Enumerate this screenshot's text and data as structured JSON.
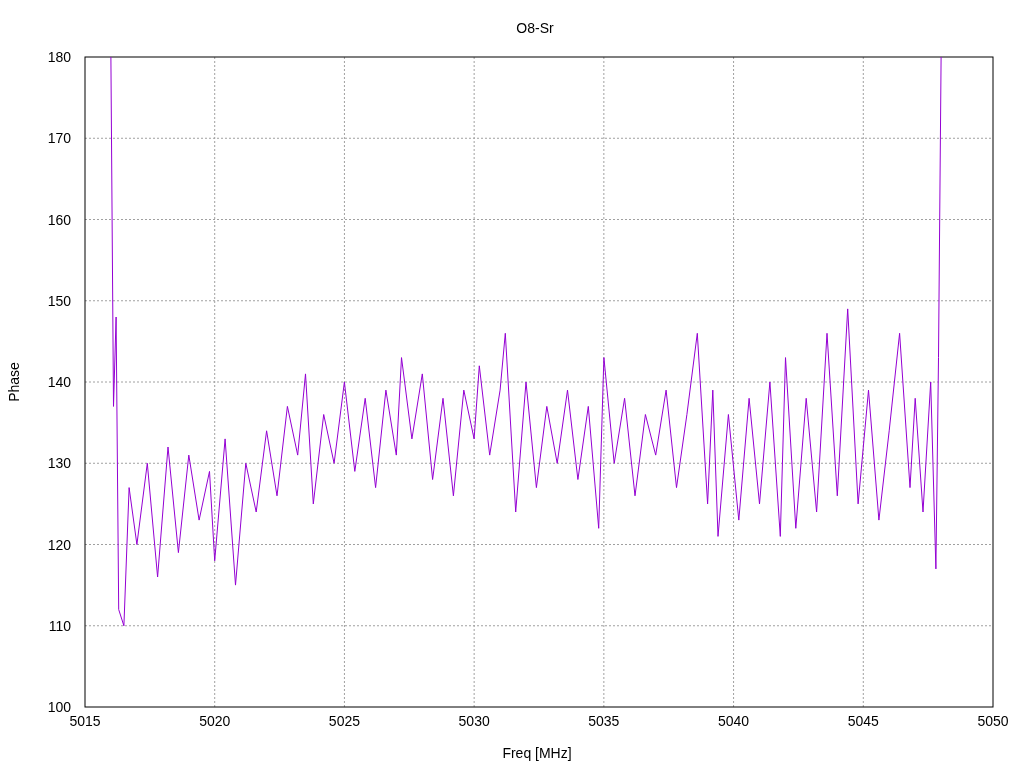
{
  "chart_data": {
    "type": "line",
    "grid": true,
    "title": "O8-Sr",
    "xlabel": "Freq [MHz]",
    "ylabel": "Phase",
    "xlim": [
      5015,
      5050
    ],
    "ylim": [
      100,
      180
    ],
    "xticks": [
      5015,
      5020,
      5025,
      5030,
      5035,
      5040,
      5045,
      5050
    ],
    "yticks": [
      100,
      110,
      120,
      130,
      140,
      150,
      160,
      170,
      180
    ],
    "x": [
      5016.0,
      5016.1,
      5016.2,
      5016.3,
      5016.5,
      5016.7,
      5017.0,
      5017.4,
      5017.8,
      5018.2,
      5018.6,
      5019.0,
      5019.4,
      5019.8,
      5020.0,
      5020.4,
      5020.8,
      5021.2,
      5021.6,
      5022.0,
      5022.4,
      5022.8,
      5023.2,
      5023.5,
      5023.8,
      5024.2,
      5024.6,
      5025.0,
      5025.4,
      5025.8,
      5026.2,
      5026.6,
      5027.0,
      5027.2,
      5027.6,
      5028.0,
      5028.4,
      5028.8,
      5029.2,
      5029.6,
      5030.0,
      5030.2,
      5030.6,
      5031.0,
      5031.2,
      5031.6,
      5032.0,
      5032.4,
      5032.8,
      5033.2,
      5033.6,
      5034.0,
      5034.4,
      5034.8,
      5035.0,
      5035.4,
      5035.8,
      5036.2,
      5036.6,
      5037.0,
      5037.4,
      5037.8,
      5038.2,
      5038.6,
      5039.0,
      5039.2,
      5039.4,
      5039.8,
      5040.2,
      5040.6,
      5041.0,
      5041.4,
      5041.8,
      5042.0,
      5042.4,
      5042.8,
      5043.2,
      5043.6,
      5044.0,
      5044.4,
      5044.8,
      5045.2,
      5045.6,
      5046.0,
      5046.4,
      5046.8,
      5047.0,
      5047.3,
      5047.6,
      5047.8,
      5047.9,
      5048.0
    ],
    "series": [
      {
        "color": "#9400d3",
        "values": [
          180,
          137,
          148,
          112,
          110,
          127,
          120,
          130,
          116,
          132,
          119,
          131,
          123,
          129,
          118,
          133,
          115,
          130,
          124,
          134,
          126,
          137,
          131,
          141,
          125,
          136,
          130,
          140,
          129,
          138,
          127,
          139,
          131,
          143,
          133,
          141,
          128,
          138,
          126,
          139,
          133,
          142,
          131,
          139,
          146,
          124,
          140,
          127,
          137,
          130,
          139,
          128,
          137,
          122,
          143,
          130,
          138,
          126,
          136,
          131,
          139,
          127,
          136,
          146,
          125,
          139,
          121,
          136,
          123,
          138,
          125,
          140,
          121,
          143,
          122,
          138,
          124,
          146,
          126,
          149,
          125,
          139,
          123,
          134,
          146,
          127,
          138,
          124,
          140,
          117,
          143,
          180
        ]
      }
    ]
  }
}
